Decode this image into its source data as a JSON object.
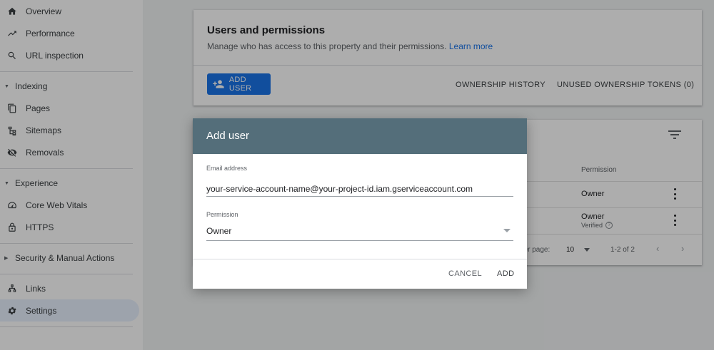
{
  "sidebar": {
    "items": [
      {
        "label": "Overview",
        "icon": "home-icon"
      },
      {
        "label": "Performance",
        "icon": "trending-up-icon"
      },
      {
        "label": "URL inspection",
        "icon": "search-icon"
      }
    ],
    "indexing": {
      "label": "Indexing",
      "items": [
        {
          "label": "Pages",
          "icon": "pages-icon"
        },
        {
          "label": "Sitemaps",
          "icon": "sitemap-icon"
        },
        {
          "label": "Removals",
          "icon": "eye-off-icon"
        }
      ]
    },
    "experience": {
      "label": "Experience",
      "items": [
        {
          "label": "Core Web Vitals",
          "icon": "speedometer-icon"
        },
        {
          "label": "HTTPS",
          "icon": "lock-icon"
        }
      ]
    },
    "security": {
      "label": "Security & Manual Actions"
    },
    "bottom_items": [
      {
        "label": "Links",
        "icon": "links-icon"
      },
      {
        "label": "Settings",
        "icon": "gear-icon",
        "active": true
      }
    ]
  },
  "users_card": {
    "title": "Users and permissions",
    "subtitle": "Manage who has access to this property and their permissions.",
    "learn_more": "Learn more",
    "add_user_label": "ADD USER",
    "ownership_history": "OWNERSHIP HISTORY",
    "unused_tokens": "UNUSED OWNERSHIP TOKENS (0)"
  },
  "users_table": {
    "permission_header": "Permission",
    "rows": [
      {
        "permission": "Owner",
        "verified": ""
      },
      {
        "permission": "Owner",
        "verified": "Verified"
      }
    ],
    "rows_per_page_label": "per page:",
    "rows_per_page_value": "10",
    "range": "1-2 of 2"
  },
  "dialog": {
    "title": "Add user",
    "email_label": "Email address",
    "email_value": "your-service-account-name@your-project-id.iam.gserviceaccount.com",
    "permission_label": "Permission",
    "permission_value": "Owner",
    "cancel_label": "CANCEL",
    "add_label": "ADD"
  },
  "colors": {
    "accent": "#1a73e8",
    "dialog_header": "#546e7a",
    "active_nav": "#e8f0fe"
  }
}
